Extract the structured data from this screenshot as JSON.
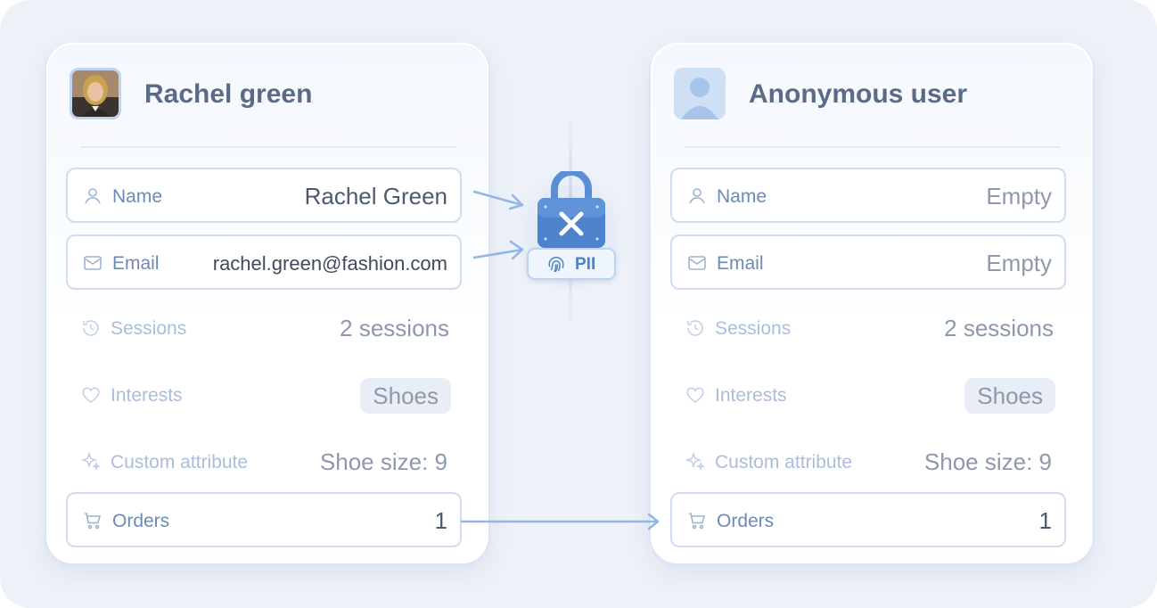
{
  "left_card": {
    "title": "Rachel green",
    "rows": [
      {
        "label": "Name",
        "value": "Rachel Green",
        "icon": "user-icon"
      },
      {
        "label": "Email",
        "value": "rachel.green@fashion.com",
        "icon": "mail-icon"
      },
      {
        "label": "Sessions",
        "value": "2 sessions",
        "icon": "history-icon"
      },
      {
        "label": "Interests",
        "value": "Shoes",
        "icon": "heart-icon"
      },
      {
        "label": "Custom attribute",
        "value": "Shoe size: 9",
        "icon": "sparkle-icon"
      },
      {
        "label": "Orders",
        "value": "1",
        "icon": "cart-icon"
      }
    ]
  },
  "right_card": {
    "title": "Anonymous user",
    "rows": [
      {
        "label": "Name",
        "value": "Empty",
        "icon": "user-icon"
      },
      {
        "label": "Email",
        "value": "Empty",
        "icon": "mail-icon"
      },
      {
        "label": "Sessions",
        "value": "2 sessions",
        "icon": "history-icon"
      },
      {
        "label": "Interests",
        "value": "Shoes",
        "icon": "heart-icon"
      },
      {
        "label": "Custom attribute",
        "value": "Shoe size: 9",
        "icon": "sparkle-icon"
      },
      {
        "label": "Orders",
        "value": "1",
        "icon": "cart-icon"
      }
    ]
  },
  "lock": {
    "badge_label": "PII",
    "icon": "lock-x-icon",
    "badge_icon": "fingerprint-icon"
  },
  "colors": {
    "accent": "#4f7fc4",
    "arrow": "#8fb6e6",
    "background": "#eef2f8"
  }
}
